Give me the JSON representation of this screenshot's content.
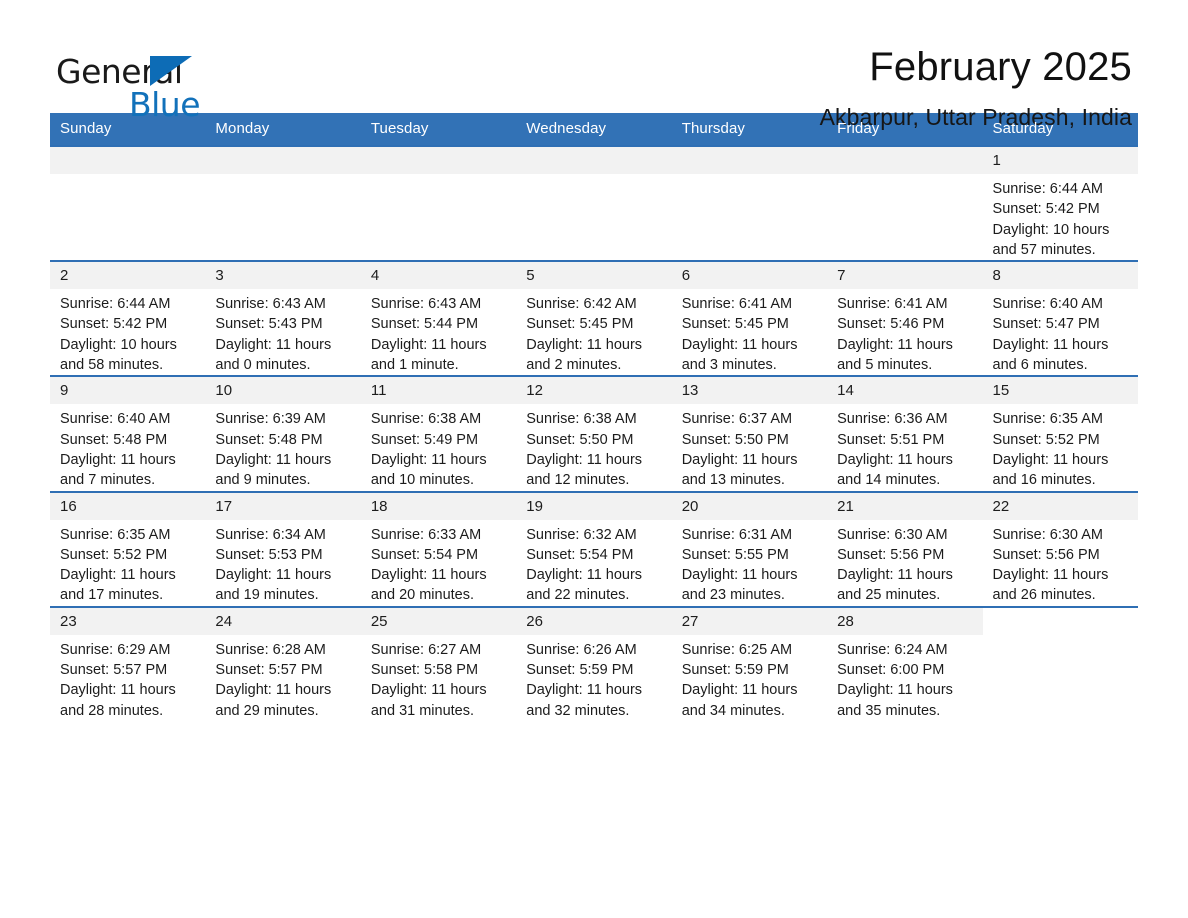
{
  "brand": {
    "word_one": "General",
    "word_two": "Blue",
    "triangle_icon": "triangle-icon",
    "accent_color": "#1271ba"
  },
  "header": {
    "title": "February 2025",
    "location": "Akbarpur, Uttar Pradesh, India"
  },
  "calendar": {
    "header_bg": "#3272b6",
    "weekdays": [
      "Sunday",
      "Monday",
      "Tuesday",
      "Wednesday",
      "Thursday",
      "Friday",
      "Saturday"
    ],
    "weeks": [
      [
        {
          "day": "",
          "blank": true
        },
        {
          "day": "",
          "blank": true
        },
        {
          "day": "",
          "blank": true
        },
        {
          "day": "",
          "blank": true
        },
        {
          "day": "",
          "blank": true
        },
        {
          "day": "",
          "blank": true
        },
        {
          "day": "1",
          "sunrise": "Sunrise: 6:44 AM",
          "sunset": "Sunset: 5:42 PM",
          "daylight": "Daylight: 10 hours and 57 minutes."
        }
      ],
      [
        {
          "day": "2",
          "sunrise": "Sunrise: 6:44 AM",
          "sunset": "Sunset: 5:42 PM",
          "daylight": "Daylight: 10 hours and 58 minutes."
        },
        {
          "day": "3",
          "sunrise": "Sunrise: 6:43 AM",
          "sunset": "Sunset: 5:43 PM",
          "daylight": "Daylight: 11 hours and 0 minutes."
        },
        {
          "day": "4",
          "sunrise": "Sunrise: 6:43 AM",
          "sunset": "Sunset: 5:44 PM",
          "daylight": "Daylight: 11 hours and 1 minute."
        },
        {
          "day": "5",
          "sunrise": "Sunrise: 6:42 AM",
          "sunset": "Sunset: 5:45 PM",
          "daylight": "Daylight: 11 hours and 2 minutes."
        },
        {
          "day": "6",
          "sunrise": "Sunrise: 6:41 AM",
          "sunset": "Sunset: 5:45 PM",
          "daylight": "Daylight: 11 hours and 3 minutes."
        },
        {
          "day": "7",
          "sunrise": "Sunrise: 6:41 AM",
          "sunset": "Sunset: 5:46 PM",
          "daylight": "Daylight: 11 hours and 5 minutes."
        },
        {
          "day": "8",
          "sunrise": "Sunrise: 6:40 AM",
          "sunset": "Sunset: 5:47 PM",
          "daylight": "Daylight: 11 hours and 6 minutes."
        }
      ],
      [
        {
          "day": "9",
          "sunrise": "Sunrise: 6:40 AM",
          "sunset": "Sunset: 5:48 PM",
          "daylight": "Daylight: 11 hours and 7 minutes."
        },
        {
          "day": "10",
          "sunrise": "Sunrise: 6:39 AM",
          "sunset": "Sunset: 5:48 PM",
          "daylight": "Daylight: 11 hours and 9 minutes."
        },
        {
          "day": "11",
          "sunrise": "Sunrise: 6:38 AM",
          "sunset": "Sunset: 5:49 PM",
          "daylight": "Daylight: 11 hours and 10 minutes."
        },
        {
          "day": "12",
          "sunrise": "Sunrise: 6:38 AM",
          "sunset": "Sunset: 5:50 PM",
          "daylight": "Daylight: 11 hours and 12 minutes."
        },
        {
          "day": "13",
          "sunrise": "Sunrise: 6:37 AM",
          "sunset": "Sunset: 5:50 PM",
          "daylight": "Daylight: 11 hours and 13 minutes."
        },
        {
          "day": "14",
          "sunrise": "Sunrise: 6:36 AM",
          "sunset": "Sunset: 5:51 PM",
          "daylight": "Daylight: 11 hours and 14 minutes."
        },
        {
          "day": "15",
          "sunrise": "Sunrise: 6:35 AM",
          "sunset": "Sunset: 5:52 PM",
          "daylight": "Daylight: 11 hours and 16 minutes."
        }
      ],
      [
        {
          "day": "16",
          "sunrise": "Sunrise: 6:35 AM",
          "sunset": "Sunset: 5:52 PM",
          "daylight": "Daylight: 11 hours and 17 minutes."
        },
        {
          "day": "17",
          "sunrise": "Sunrise: 6:34 AM",
          "sunset": "Sunset: 5:53 PM",
          "daylight": "Daylight: 11 hours and 19 minutes."
        },
        {
          "day": "18",
          "sunrise": "Sunrise: 6:33 AM",
          "sunset": "Sunset: 5:54 PM",
          "daylight": "Daylight: 11 hours and 20 minutes."
        },
        {
          "day": "19",
          "sunrise": "Sunrise: 6:32 AM",
          "sunset": "Sunset: 5:54 PM",
          "daylight": "Daylight: 11 hours and 22 minutes."
        },
        {
          "day": "20",
          "sunrise": "Sunrise: 6:31 AM",
          "sunset": "Sunset: 5:55 PM",
          "daylight": "Daylight: 11 hours and 23 minutes."
        },
        {
          "day": "21",
          "sunrise": "Sunrise: 6:30 AM",
          "sunset": "Sunset: 5:56 PM",
          "daylight": "Daylight: 11 hours and 25 minutes."
        },
        {
          "day": "22",
          "sunrise": "Sunrise: 6:30 AM",
          "sunset": "Sunset: 5:56 PM",
          "daylight": "Daylight: 11 hours and 26 minutes."
        }
      ],
      [
        {
          "day": "23",
          "sunrise": "Sunrise: 6:29 AM",
          "sunset": "Sunset: 5:57 PM",
          "daylight": "Daylight: 11 hours and 28 minutes."
        },
        {
          "day": "24",
          "sunrise": "Sunrise: 6:28 AM",
          "sunset": "Sunset: 5:57 PM",
          "daylight": "Daylight: 11 hours and 29 minutes."
        },
        {
          "day": "25",
          "sunrise": "Sunrise: 6:27 AM",
          "sunset": "Sunset: 5:58 PM",
          "daylight": "Daylight: 11 hours and 31 minutes."
        },
        {
          "day": "26",
          "sunrise": "Sunrise: 6:26 AM",
          "sunset": "Sunset: 5:59 PM",
          "daylight": "Daylight: 11 hours and 32 minutes."
        },
        {
          "day": "27",
          "sunrise": "Sunrise: 6:25 AM",
          "sunset": "Sunset: 5:59 PM",
          "daylight": "Daylight: 11 hours and 34 minutes."
        },
        {
          "day": "28",
          "sunrise": "Sunrise: 6:24 AM",
          "sunset": "Sunset: 6:00 PM",
          "daylight": "Daylight: 11 hours and 35 minutes."
        },
        {
          "day": "",
          "nodata": true
        }
      ]
    ]
  }
}
